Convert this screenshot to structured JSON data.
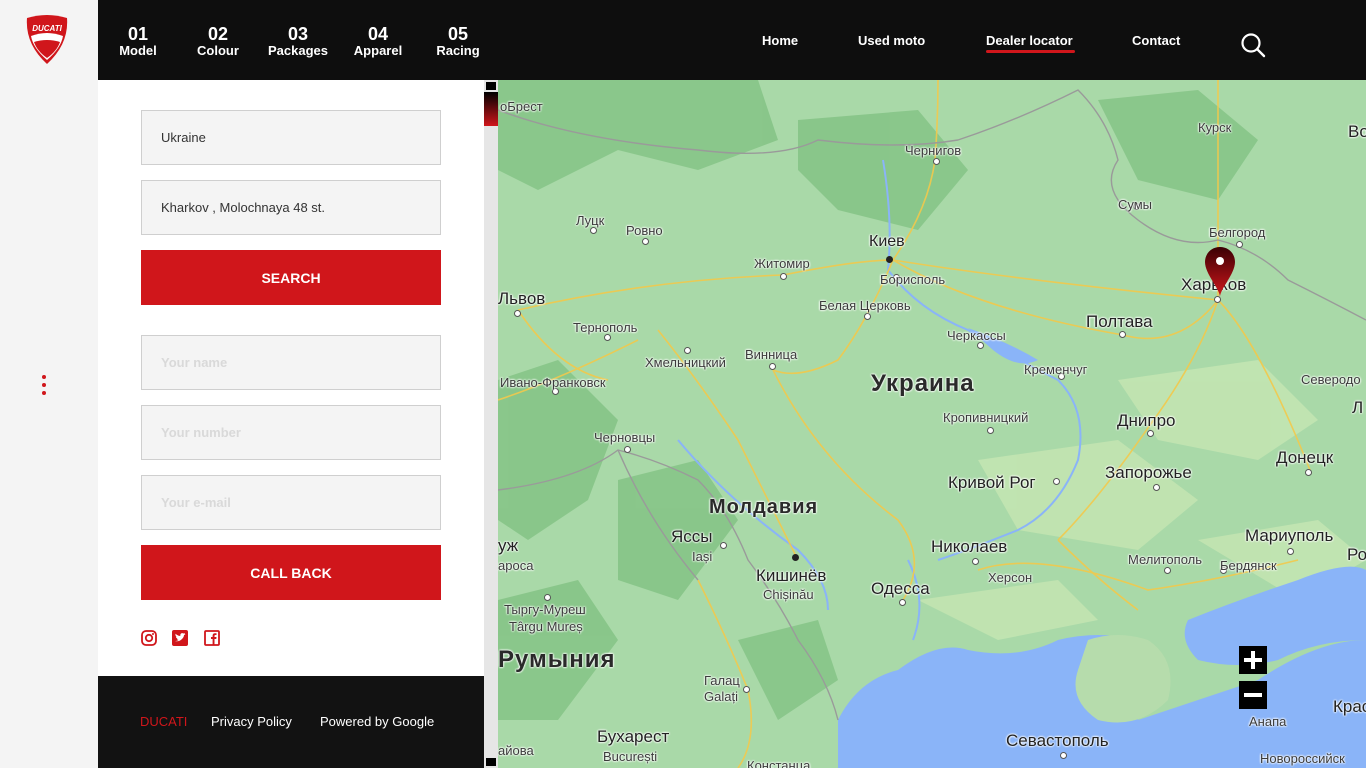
{
  "brand": {
    "logo_text": "DUCATI",
    "accent": "#d0161b"
  },
  "header": {
    "steps": [
      {
        "num": "01",
        "label": "Model"
      },
      {
        "num": "02",
        "label": "Colour"
      },
      {
        "num": "03",
        "label": "Packages"
      },
      {
        "num": "04",
        "label": "Apparel"
      },
      {
        "num": "05",
        "label": "Racing"
      }
    ],
    "nav": [
      {
        "label": "Home"
      },
      {
        "label": "Used moto"
      },
      {
        "label": "Dealer locator",
        "active": true
      },
      {
        "label": "Contact"
      }
    ],
    "search_icon": "search-icon"
  },
  "locator": {
    "country_value": "Ukraine",
    "address_value": "Kharkov , Molochnaya 48 st.",
    "search_label": "SEARCH"
  },
  "callback": {
    "name_placeholder": "Your name",
    "number_placeholder": "Your number",
    "email_placeholder": "Your e-mail",
    "button_label": "CALL BACK"
  },
  "social": [
    "instagram-icon",
    "twitter-icon",
    "facebook-icon"
  ],
  "footer": {
    "brand": "DUCATI",
    "privacy": "Privacy Policy",
    "powered": "Powered by Google"
  },
  "map": {
    "labels": {
      "brest": "оБрест",
      "kursk": "Курск",
      "chernigov": "Чернигов",
      "sumy": "Сумы",
      "belgorod": "Белгород",
      "lutsk": "Луцк",
      "rovno": "Ровно",
      "kiev": "Киев",
      "zhitomir": "Житомир",
      "borispol": "Борисполь",
      "kharkov": "Харьков",
      "lvov": "Львов",
      "ternopol": "Тернополь",
      "belaya": "Белая Церковь",
      "poltava": "Полтава",
      "cherkassy": "Черкассы",
      "khmelnitsky": "Хмельницкий",
      "vinnitsa": "Винница",
      "ukraine": "Украина",
      "kremenchug": "Кременчуг",
      "ivano": "Ивано-Франковск",
      "severodonetsk": "Северодо",
      "kropivnitsky": "Кропивницкий",
      "dnipro": "Днипро",
      "chernovtsy": "Черновцы",
      "donetsk": "Донецк",
      "krivoy": "Кривой Рог",
      "zaporozhye": "Запорожье",
      "moldova": "Молдавия",
      "yassy": "Яссы",
      "iasi": "Iași",
      "nikolaev": "Николаев",
      "mariupol": "Мариуполь",
      "kherson": "Херсон",
      "melitopol": "Мелитополь",
      "berdyansk": "Бердянск",
      "kishinev": "Кишинёв",
      "chisinau": "Chișinău",
      "odessa": "Одесса",
      "targu1": "Тыргу-Муреш",
      "targu2": "Târgu Mureș",
      "romania": "Румыния",
      "galats1": "Галац",
      "galats2": "Galați",
      "bucharest1": "Бухарест",
      "bucharest2": "București",
      "sevastopol": "Севастополь",
      "anapa": "Анапа",
      "novoross": "Новороссийск",
      "konstanta": "Констанца",
      "zh": "ж",
      "uzh": "уж",
      "rosa": "ароса",
      "krasn": "Крас",
      "ro": "Ро",
      "vo": "Во",
      "l": "Л",
      "aiova": "айова"
    }
  }
}
